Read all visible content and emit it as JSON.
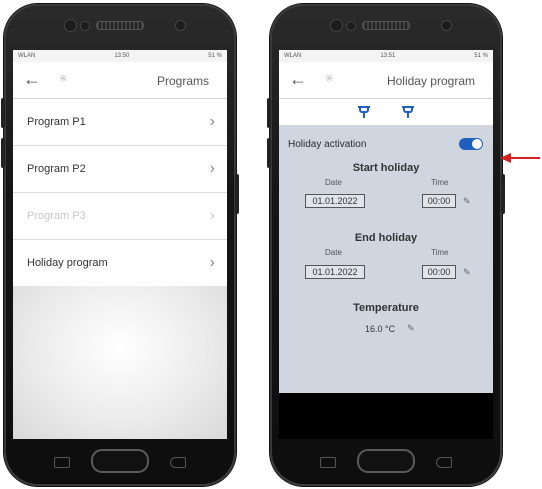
{
  "left_phone": {
    "status": {
      "carrier": "WLAN",
      "time": "13:50",
      "battery": "51 %"
    },
    "header": {
      "back_icon": "arrow-left-icon",
      "bluetooth_icon": "bluetooth-icon",
      "title": "Programs"
    },
    "items": [
      {
        "label": "Program P1",
        "disabled": false
      },
      {
        "label": "Program P2",
        "disabled": false
      },
      {
        "label": "Program P3",
        "disabled": true
      },
      {
        "label": "Holiday program",
        "disabled": false
      }
    ]
  },
  "right_phone": {
    "status": {
      "carrier": "WLAN",
      "time": "13:51",
      "battery": "51 %"
    },
    "header": {
      "back_icon": "arrow-left-icon",
      "bluetooth_icon": "bluetooth-icon",
      "title": "Holiday program"
    },
    "toolbar_icons": [
      "tap-icon",
      "tap-icon"
    ],
    "holiday": {
      "activation_label": "Holiday activation",
      "activation_on": true,
      "start": {
        "title": "Start holiday",
        "date_label": "Date",
        "date": "01.01.2022",
        "time_label": "Time",
        "time": "00:00"
      },
      "end": {
        "title": "End holiday",
        "date_label": "Date",
        "date": "01.01.2022",
        "time_label": "Time",
        "time": "00:00"
      },
      "temperature": {
        "title": "Temperature",
        "value": "16.0 °C"
      }
    }
  },
  "colors": {
    "accent": "#1f5fbf",
    "panel": "#cfd6df",
    "arrow": "#d42020"
  },
  "annotation": {
    "arrow_icon": "red-arrow-icon",
    "points_to": "holiday-activation-toggle"
  }
}
